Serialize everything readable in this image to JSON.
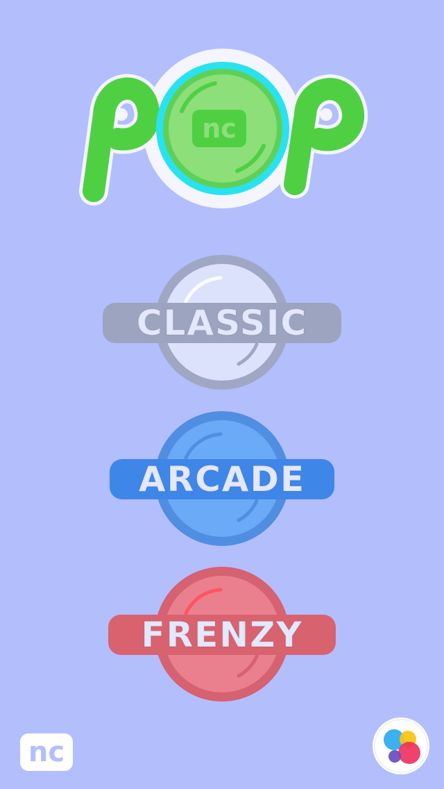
{
  "logo": {
    "title": "POP",
    "badge_text": "nc",
    "color": "#4fd043",
    "ring_color": "#29e2f0"
  },
  "modes": [
    {
      "id": "classic",
      "label": "CLASSIC",
      "fill": "#dde2fc",
      "rim": "#a0a7c4",
      "label_bg": "#9ca4bf"
    },
    {
      "id": "arcade",
      "label": "ARCADE",
      "fill": "#6aaaf6",
      "rim": "#4f8ee1",
      "label_bg": "#3f86e9"
    },
    {
      "id": "frenzy",
      "label": "FRENZY",
      "fill": "#ea808e",
      "rim": "#d66171",
      "label_bg": "#d9626f"
    }
  ],
  "footer": {
    "brand_text": "nc",
    "game_center_icon": "game-center-icon"
  }
}
